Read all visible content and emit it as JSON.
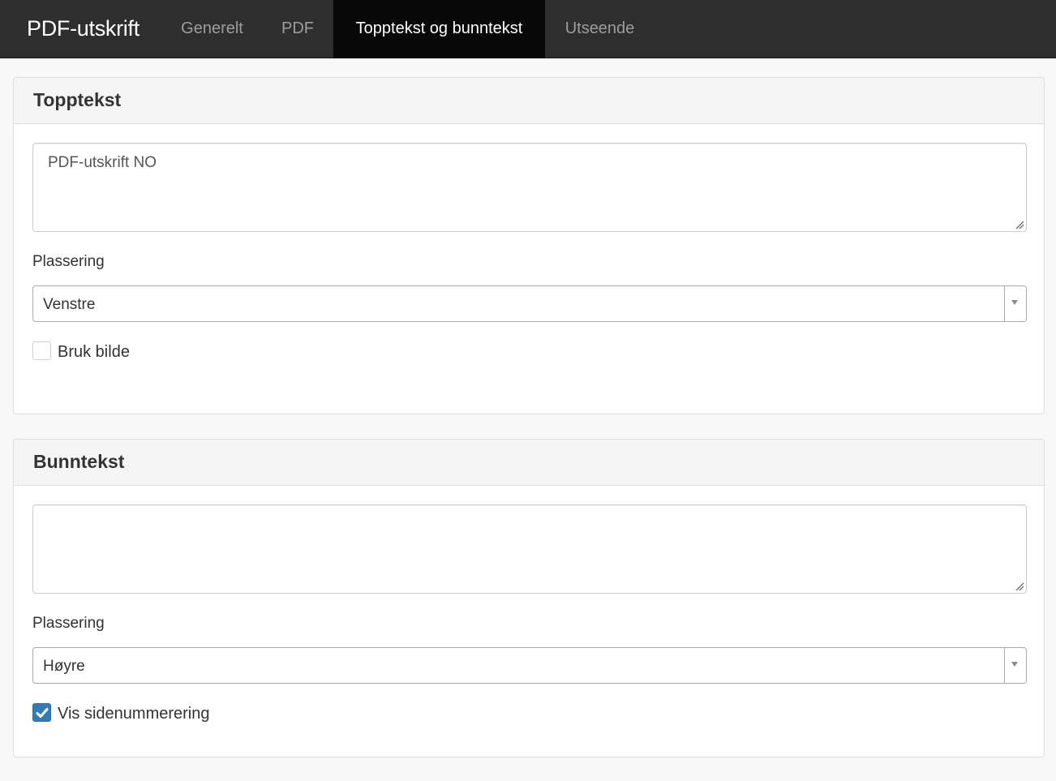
{
  "app": {
    "brand": "PDF-utskrift"
  },
  "nav": {
    "tabs": [
      {
        "label": "Generelt",
        "active": false
      },
      {
        "label": "PDF",
        "active": false
      },
      {
        "label": "Topptekst og bunntekst",
        "active": true
      },
      {
        "label": "Utseende",
        "active": false
      }
    ]
  },
  "header_panel": {
    "title": "Topptekst",
    "text_value": "PDF-utskrift NO",
    "placement_label": "Plassering",
    "placement_value": "Venstre",
    "checkbox_label": "Bruk bilde",
    "checkbox_checked": false
  },
  "footer_panel": {
    "title": "Bunntekst",
    "text_value": "",
    "placement_label": "Plassering",
    "placement_value": "Høyre",
    "checkbox_label": "Vis sidenummerering",
    "checkbox_checked": true
  },
  "colors": {
    "navbar": "#2e2e2e",
    "active_tab": "#080808",
    "checkbox_accent": "#337ab7"
  },
  "icons": [
    "resize-grip-icon",
    "chevron-down-icon",
    "checkmark-icon"
  ]
}
